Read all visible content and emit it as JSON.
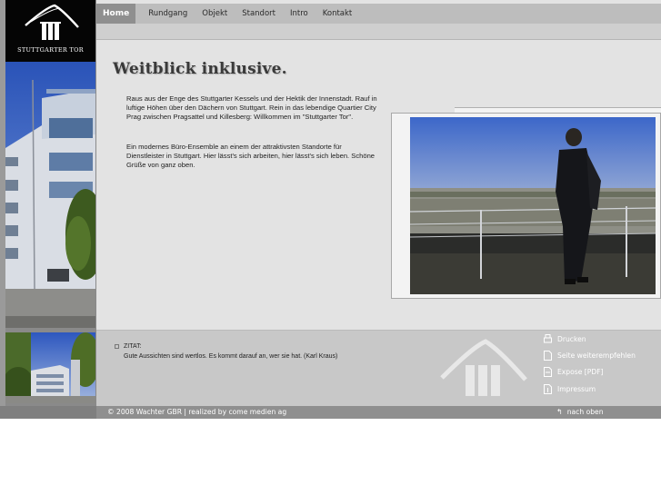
{
  "brand": {
    "logo_text": "STUTTGARTER TOR"
  },
  "nav": {
    "home": "Home",
    "items": [
      "Rundgang",
      "Objekt",
      "Standort",
      "Intro",
      "Kontakt"
    ]
  },
  "content": {
    "headline": "Weitblick inklusive.",
    "paragraph1": "Raus aus der Enge des Stuttgarter Kessels und der Hektik der Innenstadt. Rauf in luftige Höhen über den Dächern von Stuttgart. Rein in das lebendige Quartier City Prag zwischen Pragsattel und Killesberg: Willkommen im \"Stuttgarter Tor\".",
    "paragraph2": "Ein modernes Büro-Ensemble an einem der attraktivsten Standorte für Dienstleister in Stuttgart. Hier lässt's sich arbeiten, hier lässt's sich leben. Schöne Grüße von ganz oben."
  },
  "quote": {
    "label": "ZITAT:",
    "text": "Gute Aussichten sind wertlos. Es kommt darauf an, wer sie hat. (Karl Kraus)"
  },
  "side_links": {
    "print": "Drucken",
    "recommend": "Seite weiterempfehlen",
    "expose": "Expose [PDF]",
    "imprint": "Impressum"
  },
  "footer": {
    "copyright": "© 2008 Wachter GBR | realized by come medien ag",
    "to_top": "nach oben"
  },
  "icons": {
    "print": "print-icon",
    "document": "document-icon",
    "pdf": "pdf-icon",
    "info": "info-icon",
    "back_to_top": "back-to-top-icon"
  },
  "colors": {
    "background": "#e3e3e3",
    "nav_bar": "#bdbdbd",
    "nav_active": "#8f8f8f",
    "footer": "#8f8f8f"
  }
}
